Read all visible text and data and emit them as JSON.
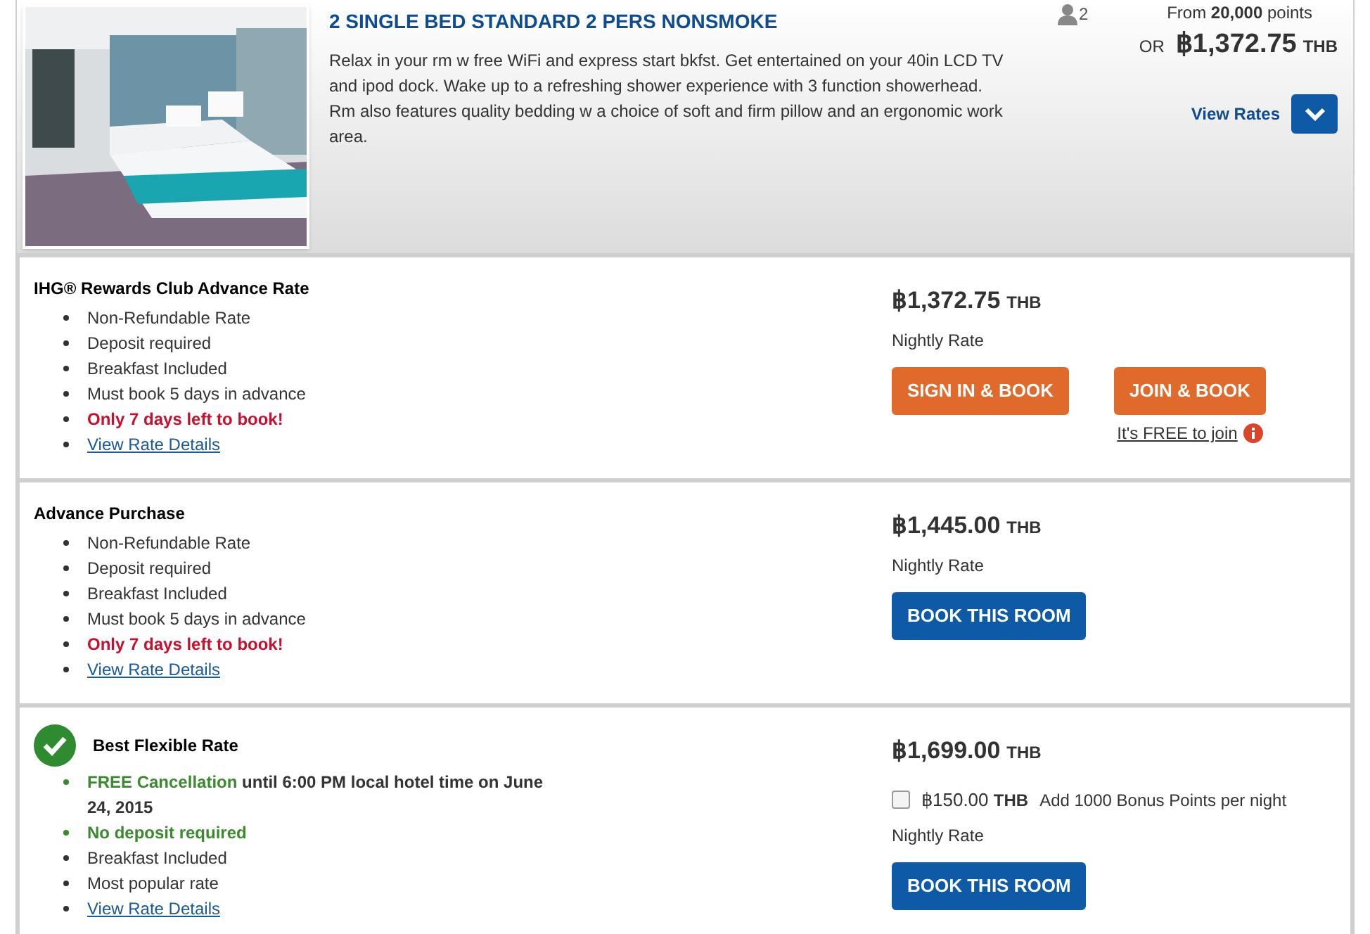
{
  "room": {
    "kind": "picture",
    "title": "2 SINGLE BED STANDARD 2 PERS NONSMOKE",
    "description": "Relax in your rm w free WiFi and express start bkfst. Get entertained on your 40in LCD TV and ipod dock. Wake up to a refreshing shower experience with 3 function showerhead. Rm also features quality bedding w a choice of soft and firm pillow and an ergonomic work area.",
    "guests": "2",
    "points_prefix": "From",
    "points": "20,000",
    "points_suffix": "points",
    "or": "OR",
    "price": "฿1,372.75",
    "currency": "THB",
    "view_rates": "View Rates",
    "expanded": true
  },
  "rates": [
    {
      "title": "IHG® Rewards Club Advance Rate",
      "check": false,
      "items": [
        {
          "kind": "normal",
          "text": "Non-Refundable Rate"
        },
        {
          "kind": "normal",
          "text": "Deposit required"
        },
        {
          "kind": "normal",
          "text": "Breakfast Included"
        },
        {
          "kind": "normal",
          "text": "Must book 5 days in advance"
        },
        {
          "kind": "warning",
          "text": "Only 7 days left to book!"
        },
        {
          "kind": "link",
          "text": "View Rate Details"
        }
      ],
      "price": "฿1,372.75",
      "currency": "THB",
      "nightly": "Nightly Rate",
      "buttons": [
        {
          "kind": "orange",
          "label": "SIGN IN & BOOK"
        },
        {
          "kind": "orange",
          "label": "JOIN & BOOK",
          "note": "It's FREE to join"
        }
      ]
    },
    {
      "title": "Advance Purchase",
      "check": false,
      "items": [
        {
          "kind": "normal",
          "text": "Non-Refundable Rate"
        },
        {
          "kind": "normal",
          "text": "Deposit required"
        },
        {
          "kind": "normal",
          "text": "Breakfast Included"
        },
        {
          "kind": "normal",
          "text": "Must book 5 days in advance"
        },
        {
          "kind": "warning",
          "text": "Only 7 days left to book!"
        },
        {
          "kind": "link",
          "text": "View Rate Details"
        }
      ],
      "price": "฿1,445.00",
      "currency": "THB",
      "nightly": "Nightly Rate",
      "buttons": [
        {
          "kind": "blue",
          "label": "BOOK THIS ROOM"
        }
      ]
    },
    {
      "title": "Best Flexible Rate",
      "check": true,
      "items": [
        {
          "kind": "green",
          "highlight": "FREE Cancellation",
          "text": "until 6:00 PM local hotel time on June 24, 2015"
        },
        {
          "kind": "green",
          "text": "No deposit required"
        },
        {
          "kind": "normal",
          "text": "Breakfast Included"
        },
        {
          "kind": "normal",
          "text": "Most popular rate"
        },
        {
          "kind": "link",
          "text": "View Rate Details"
        }
      ],
      "price": "฿1,699.00",
      "currency": "THB",
      "addon": {
        "checked": false,
        "price": "฿150.00",
        "currency": "THB",
        "text": "Add 1000 Bonus Points per night"
      },
      "nightly": "Nightly Rate",
      "buttons": [
        {
          "kind": "blue",
          "label": "BOOK THIS ROOM"
        }
      ]
    }
  ]
}
